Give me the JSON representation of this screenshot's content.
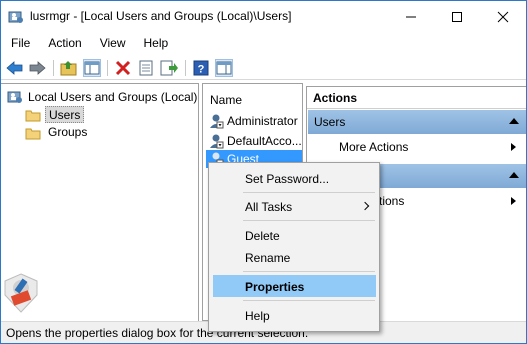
{
  "window": {
    "title": "lusrmgr - [Local Users and Groups (Local)\\Users]",
    "controls": {
      "minimize_icon": "minimize-icon",
      "maximize_icon": "maximize-icon",
      "close_icon": "close-icon"
    }
  },
  "menu": [
    "File",
    "Action",
    "View",
    "Help"
  ],
  "toolbar": {
    "icons": [
      "back-arrow-icon",
      "forward-arrow-icon",
      "up-folder-icon",
      "show-hide-tree-icon",
      "delete-icon",
      "properties-icon",
      "export-list-icon",
      "help-icon",
      "show-hide-action-pane-icon"
    ]
  },
  "tree": {
    "root": "Local Users and Groups (Local)",
    "items": [
      {
        "label": "Users",
        "selected": true
      },
      {
        "label": "Groups",
        "selected": false
      }
    ]
  },
  "list": {
    "column_header": "Name",
    "users": [
      {
        "label": "Administrator",
        "selected": false
      },
      {
        "label": "DefaultAcco...",
        "selected": false
      },
      {
        "label": "Guest",
        "selected": true
      }
    ]
  },
  "actions": {
    "title": "Actions",
    "groups": [
      {
        "label": "Users",
        "items": [
          "More Actions"
        ]
      },
      {
        "label": "",
        "items": [
          "...tions"
        ]
      }
    ]
  },
  "context_menu": {
    "items": [
      {
        "label": "Set Password...",
        "highlight": false
      },
      {
        "label": "All Tasks",
        "submenu": true,
        "highlight": false
      },
      {
        "label": "Delete",
        "highlight": false
      },
      {
        "label": "Rename",
        "highlight": false
      },
      {
        "label": "Properties",
        "highlight": true
      },
      {
        "label": "Help",
        "highlight": false
      }
    ]
  },
  "status": "Opens the properties dialog box for the current selection.",
  "colors": {
    "accent_border": "#2b79c8",
    "selection_blue": "#3399ff",
    "menu_highlight": "#91c9f7",
    "actions_group_bg": "#8db4de"
  }
}
